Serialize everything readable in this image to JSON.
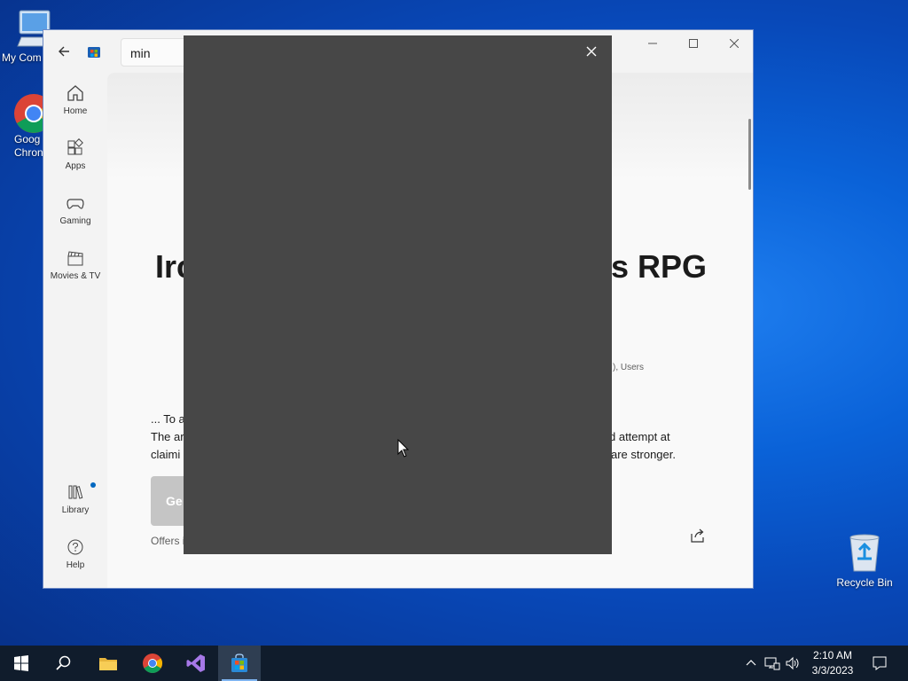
{
  "desktop": {
    "icons": [
      {
        "label": "My Computer",
        "visible_label": "My Com"
      },
      {
        "label": "Google Chrome",
        "line1": "Goog",
        "line2": "Chron"
      },
      {
        "label": "Recycle Bin"
      }
    ]
  },
  "window": {
    "search_value": "min",
    "nav": [
      {
        "label": "Home"
      },
      {
        "label": "Apps"
      },
      {
        "label": "Gaming"
      },
      {
        "label": "Movies & TV"
      },
      {
        "label": "Library"
      },
      {
        "label": "Help"
      }
    ],
    "app_title_left": "Irc",
    "app_title_right": "s RPG",
    "meta_users": "), Users",
    "desc_line1_left": "... To a",
    "desc_line2_left": "The ar",
    "desc_line2_right": "d attempt at",
    "desc_line3_left": "claimi",
    "desc_line3_right": "are stronger.",
    "get_button": "Ge",
    "offers": "Offers i"
  },
  "taskbar": {
    "time": "2:10 AM",
    "date": "3/3/2023"
  },
  "colors": {
    "overlay": "#474747",
    "taskbar": "#101c2c",
    "accent": "#0067c0"
  }
}
